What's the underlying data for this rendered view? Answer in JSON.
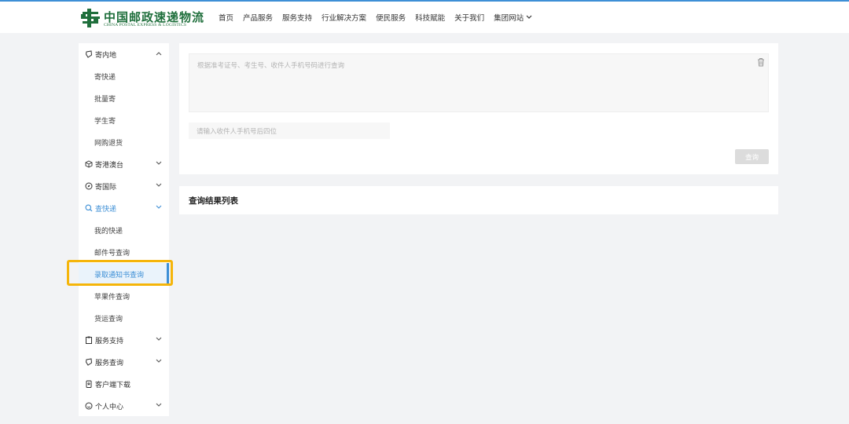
{
  "brand": {
    "name_cn": "中国邮政速递物流",
    "name_en": "CHINA POSTAL EXPRESS & LOGISTICS",
    "color": "#1f6f3c"
  },
  "nav": {
    "items": [
      "首页",
      "产品服务",
      "服务支持",
      "行业解决方案",
      "便民服务",
      "科技赋能",
      "关于我们",
      "集团网站"
    ]
  },
  "sidebar": {
    "groups": [
      {
        "label": "寄内地",
        "icon": "shield-icon",
        "expanded": true,
        "items": [
          "寄快递",
          "批量寄",
          "学生寄",
          "网购退货"
        ]
      },
      {
        "label": "寄港澳台",
        "icon": "cube-icon",
        "expanded": false
      },
      {
        "label": "寄国际",
        "icon": "compass-icon",
        "expanded": false
      },
      {
        "label": "查快递",
        "icon": "search-icon",
        "expanded": true,
        "active": true,
        "items": [
          "我的快递",
          "邮件号查询",
          "录取通知书查询",
          "苹果件查询",
          "货运查询"
        ],
        "active_item": "录取通知书查询"
      },
      {
        "label": "服务支持",
        "icon": "clipboard-icon",
        "expanded": false
      },
      {
        "label": "服务查询",
        "icon": "shield-icon",
        "expanded": false
      },
      {
        "label": "客户端下载",
        "icon": "device-icon",
        "expanded": false
      },
      {
        "label": "个人中心",
        "icon": "smile-icon",
        "expanded": false
      }
    ]
  },
  "query_form": {
    "textarea_placeholder": "根据准考证号、考生号、收件人手机号码进行查询",
    "phone_placeholder": "请输入收件人手机号后四位",
    "submit_label": "查询"
  },
  "results": {
    "title": "查询结果列表"
  },
  "colors": {
    "accent": "#3d8fd6",
    "highlight": "#f5b50a",
    "background": "#f2f3f5"
  }
}
